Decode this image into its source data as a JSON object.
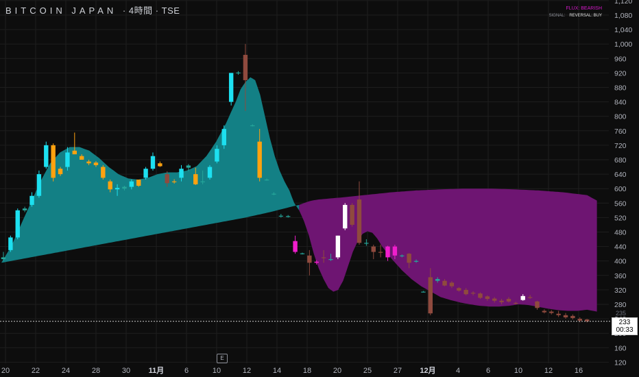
{
  "title": {
    "symbol": "BITCOIN JAPAN",
    "suffix": "· 4時間 · TSE"
  },
  "legend": {
    "flux_text": "FLUX: BEARISH",
    "signal_label": "SIGNAL:",
    "signal_value": "REVERSAL: BUY"
  },
  "colors": {
    "bg": "#0d0d0d",
    "grid": "#1e1e1e",
    "teal_fill": "#138085",
    "purple_fill": "#6e1572",
    "cyan": "#1de0f0",
    "white": "#ffffff",
    "orange": "#ffa20f",
    "magenta": "#f01ecc",
    "brown": "#8f4a3e",
    "green": "#26a69a"
  },
  "price_axis": {
    "ticks": [
      120,
      160,
      200,
      240,
      280,
      320,
      360,
      400,
      440,
      480,
      520,
      560,
      600,
      640,
      680,
      720,
      760,
      800,
      840,
      880,
      920,
      960,
      1000,
      1040,
      1080,
      1120
    ]
  },
  "time_axis": {
    "ticks": [
      {
        "label": "20",
        "idx": 0
      },
      {
        "label": "22",
        "idx": 4
      },
      {
        "label": "24",
        "idx": 8
      },
      {
        "label": "28",
        "idx": 12
      },
      {
        "label": "30",
        "idx": 16
      },
      {
        "label": "11月",
        "idx": 20,
        "bold": true
      },
      {
        "label": "6",
        "idx": 24
      },
      {
        "label": "10",
        "idx": 28
      },
      {
        "label": "12",
        "idx": 32
      },
      {
        "label": "14",
        "idx": 36
      },
      {
        "label": "18",
        "idx": 40
      },
      {
        "label": "20",
        "idx": 44
      },
      {
        "label": "25",
        "idx": 48
      },
      {
        "label": "27",
        "idx": 52
      },
      {
        "label": "12月",
        "idx": 56,
        "bold": true
      },
      {
        "label": "4",
        "idx": 60
      },
      {
        "label": "6",
        "idx": 64
      },
      {
        "label": "10",
        "idx": 68
      },
      {
        "label": "12",
        "idx": 72
      },
      {
        "label": "16",
        "idx": 76
      }
    ]
  },
  "earnings_badge": "E",
  "last_price": {
    "value": "233",
    "countdown": "00:33",
    "prev": "235"
  },
  "chart_data": {
    "type": "candlestick",
    "ylim": [
      110,
      1140
    ],
    "candles": [
      {
        "o": 405,
        "h": 425,
        "l": 400,
        "c": 410,
        "col": "green"
      },
      {
        "o": 430,
        "h": 470,
        "l": 425,
        "c": 465,
        "col": "cyan"
      },
      {
        "o": 465,
        "h": 545,
        "l": 460,
        "c": 540,
        "col": "cyan"
      },
      {
        "o": 540,
        "h": 550,
        "l": 535,
        "c": 545,
        "col": "green"
      },
      {
        "o": 555,
        "h": 590,
        "l": 550,
        "c": 580,
        "col": "cyan"
      },
      {
        "o": 580,
        "h": 650,
        "l": 575,
        "c": 640,
        "col": "cyan"
      },
      {
        "o": 660,
        "h": 730,
        "l": 655,
        "c": 720,
        "col": "cyan"
      },
      {
        "o": 720,
        "h": 725,
        "l": 620,
        "c": 630,
        "col": "orange"
      },
      {
        "o": 640,
        "h": 660,
        "l": 635,
        "c": 655,
        "col": "orange"
      },
      {
        "o": 660,
        "h": 715,
        "l": 650,
        "c": 700,
        "col": "cyan"
      },
      {
        "o": 705,
        "h": 755,
        "l": 695,
        "c": 695,
        "col": "orange"
      },
      {
        "o": 690,
        "h": 695,
        "l": 680,
        "c": 680,
        "col": "orange"
      },
      {
        "o": 675,
        "h": 680,
        "l": 665,
        "c": 670,
        "col": "orange"
      },
      {
        "o": 672,
        "h": 676,
        "l": 660,
        "c": 665,
        "col": "orange"
      },
      {
        "o": 660,
        "h": 665,
        "l": 625,
        "c": 630,
        "col": "orange"
      },
      {
        "o": 620,
        "h": 625,
        "l": 590,
        "c": 598,
        "col": "orange"
      },
      {
        "o": 598,
        "h": 612,
        "l": 580,
        "c": 602,
        "col": "cyan"
      },
      {
        "o": 600,
        "h": 608,
        "l": 595,
        "c": 605,
        "col": "green"
      },
      {
        "o": 605,
        "h": 625,
        "l": 598,
        "c": 620,
        "col": "cyan"
      },
      {
        "o": 625,
        "h": 615,
        "l": 605,
        "c": 608,
        "col": "orange"
      },
      {
        "o": 630,
        "h": 660,
        "l": 625,
        "c": 655,
        "col": "cyan"
      },
      {
        "o": 655,
        "h": 700,
        "l": 650,
        "c": 690,
        "col": "cyan"
      },
      {
        "o": 670,
        "h": 675,
        "l": 660,
        "c": 662,
        "col": "orange"
      },
      {
        "o": 640,
        "h": 648,
        "l": 605,
        "c": 615,
        "col": "brown"
      },
      {
        "o": 620,
        "h": 626,
        "l": 614,
        "c": 620,
        "col": "orange"
      },
      {
        "o": 630,
        "h": 665,
        "l": 620,
        "c": 655,
        "col": "cyan"
      },
      {
        "o": 658,
        "h": 668,
        "l": 648,
        "c": 664,
        "col": "green"
      },
      {
        "o": 640,
        "h": 658,
        "l": 610,
        "c": 612,
        "col": "orange"
      },
      {
        "o": 618,
        "h": 650,
        "l": 612,
        "c": 620,
        "col": "green"
      },
      {
        "o": 630,
        "h": 665,
        "l": 625,
        "c": 660,
        "col": "cyan"
      },
      {
        "o": 675,
        "h": 720,
        "l": 670,
        "c": 710,
        "col": "cyan"
      },
      {
        "o": 720,
        "h": 775,
        "l": 710,
        "c": 765,
        "col": "cyan"
      },
      {
        "o": 840,
        "h": 920,
        "l": 830,
        "c": 920,
        "col": "cyan"
      },
      {
        "o": 920,
        "h": 925,
        "l": 915,
        "c": 921,
        "col": "green"
      },
      {
        "o": 970,
        "h": 1000,
        "l": 815,
        "c": 900,
        "col": "brown"
      },
      {
        "o": 775,
        "h": 778,
        "l": 772,
        "c": 775,
        "col": "green"
      },
      {
        "o": 730,
        "h": 765,
        "l": 620,
        "c": 630,
        "col": "orange"
      },
      {
        "o": 625,
        "h": 628,
        "l": 622,
        "c": 624,
        "col": "green"
      },
      {
        "o": 585,
        "h": 590,
        "l": 582,
        "c": 586,
        "col": "green"
      },
      {
        "o": 525,
        "h": 530,
        "l": 520,
        "c": 525,
        "col": "green"
      },
      {
        "o": 524,
        "h": 527,
        "l": 520,
        "c": 523,
        "col": "green"
      },
      {
        "o": 455,
        "h": 470,
        "l": 420,
        "c": 425,
        "col": "magenta"
      },
      {
        "o": 420,
        "h": 423,
        "l": 418,
        "c": 421,
        "col": "green"
      },
      {
        "o": 415,
        "h": 430,
        "l": 360,
        "c": 395,
        "col": "brown"
      },
      {
        "o": 398,
        "h": 402,
        "l": 390,
        "c": 395,
        "col": "magenta"
      },
      {
        "o": 410,
        "h": 430,
        "l": 395,
        "c": 410,
        "col": "brown"
      },
      {
        "o": 405,
        "h": 420,
        "l": 400,
        "c": 405,
        "col": "green"
      },
      {
        "o": 410,
        "h": 470,
        "l": 405,
        "c": 470,
        "col": "white"
      },
      {
        "o": 490,
        "h": 560,
        "l": 485,
        "c": 555,
        "col": "white"
      },
      {
        "o": 555,
        "h": 560,
        "l": 495,
        "c": 500,
        "col": "brown"
      },
      {
        "o": 450,
        "h": 620,
        "l": 445,
        "c": 570,
        "col": "brown"
      },
      {
        "o": 448,
        "h": 460,
        "l": 442,
        "c": 450,
        "col": "green"
      },
      {
        "o": 440,
        "h": 445,
        "l": 405,
        "c": 425,
        "col": "brown"
      },
      {
        "o": 425,
        "h": 445,
        "l": 410,
        "c": 425,
        "col": "brown"
      },
      {
        "o": 440,
        "h": 442,
        "l": 400,
        "c": 410,
        "col": "magenta"
      },
      {
        "o": 440,
        "h": 445,
        "l": 405,
        "c": 415,
        "col": "magenta"
      },
      {
        "o": 415,
        "h": 418,
        "l": 410,
        "c": 413,
        "col": "green"
      },
      {
        "o": 420,
        "h": 422,
        "l": 380,
        "c": 395,
        "col": "brown"
      },
      {
        "o": 400,
        "h": 404,
        "l": 395,
        "c": 400,
        "col": "green"
      },
      {
        "o": 315,
        "h": 317,
        "l": 313,
        "c": 315,
        "col": "green"
      },
      {
        "o": 355,
        "h": 380,
        "l": 250,
        "c": 255,
        "col": "brown"
      },
      {
        "o": 350,
        "h": 355,
        "l": 340,
        "c": 345,
        "col": "green"
      },
      {
        "o": 345,
        "h": 350,
        "l": 330,
        "c": 332,
        "col": "brown"
      },
      {
        "o": 340,
        "h": 344,
        "l": 325,
        "c": 330,
        "col": "brown"
      },
      {
        "o": 325,
        "h": 328,
        "l": 315,
        "c": 318,
        "col": "brown"
      },
      {
        "o": 320,
        "h": 325,
        "l": 305,
        "c": 308,
        "col": "brown"
      },
      {
        "o": 310,
        "h": 316,
        "l": 305,
        "c": 312,
        "col": "brown"
      },
      {
        "o": 310,
        "h": 313,
        "l": 295,
        "c": 298,
        "col": "brown"
      },
      {
        "o": 302,
        "h": 305,
        "l": 290,
        "c": 295,
        "col": "brown"
      },
      {
        "o": 296,
        "h": 300,
        "l": 285,
        "c": 290,
        "col": "brown"
      },
      {
        "o": 290,
        "h": 295,
        "l": 280,
        "c": 286,
        "col": "brown"
      },
      {
        "o": 295,
        "h": 300,
        "l": 285,
        "c": 288,
        "col": "brown"
      },
      {
        "o": 284,
        "h": 287,
        "l": 280,
        "c": 282,
        "col": "brown"
      },
      {
        "o": 292,
        "h": 308,
        "l": 290,
        "c": 303,
        "col": "white"
      },
      {
        "o": 300,
        "h": 306,
        "l": 295,
        "c": 298,
        "col": "brown"
      },
      {
        "o": 288,
        "h": 290,
        "l": 265,
        "c": 270,
        "col": "brown"
      },
      {
        "o": 262,
        "h": 266,
        "l": 255,
        "c": 258,
        "col": "brown"
      },
      {
        "o": 260,
        "h": 264,
        "l": 252,
        "c": 256,
        "col": "brown"
      },
      {
        "o": 254,
        "h": 262,
        "l": 245,
        "c": 250,
        "col": "brown"
      },
      {
        "o": 250,
        "h": 256,
        "l": 240,
        "c": 244,
        "col": "brown"
      },
      {
        "o": 248,
        "h": 252,
        "l": 238,
        "c": 242,
        "col": "brown"
      },
      {
        "o": 240,
        "h": 244,
        "l": 230,
        "c": 235,
        "col": "brown"
      },
      {
        "o": 238,
        "h": 240,
        "l": 230,
        "c": 233,
        "col": "brown"
      }
    ],
    "cloud_upper": [
      [
        0,
        395
      ],
      [
        2,
        440
      ],
      [
        4,
        500
      ],
      [
        6,
        560
      ],
      [
        8,
        620
      ],
      [
        10,
        670
      ],
      [
        12,
        700
      ],
      [
        14,
        715
      ],
      [
        16,
        715
      ],
      [
        18,
        705
      ],
      [
        20,
        685
      ],
      [
        22,
        660
      ],
      [
        24,
        640
      ],
      [
        26,
        628
      ],
      [
        28,
        625
      ],
      [
        30,
        630
      ],
      [
        32,
        640
      ],
      [
        34,
        645
      ],
      [
        36,
        645
      ],
      [
        38,
        650
      ],
      [
        40,
        662
      ],
      [
        42,
        690
      ],
      [
        44,
        730
      ],
      [
        46,
        780
      ],
      [
        48,
        840
      ],
      [
        49,
        875
      ],
      [
        50,
        895
      ],
      [
        51,
        908
      ],
      [
        52,
        900
      ],
      [
        53,
        860
      ],
      [
        54,
        800
      ],
      [
        55,
        740
      ],
      [
        56,
        690
      ],
      [
        57,
        650
      ],
      [
        58,
        620
      ],
      [
        59,
        595
      ],
      [
        60,
        560
      ],
      [
        61,
        540
      ],
      [
        62,
        510
      ],
      [
        63,
        470
      ],
      [
        64,
        420
      ],
      [
        65,
        380
      ],
      [
        66,
        350
      ],
      [
        67,
        325
      ],
      [
        68,
        315
      ],
      [
        69,
        320
      ],
      [
        70,
        345
      ],
      [
        71,
        385
      ],
      [
        72,
        425
      ],
      [
        73,
        455
      ],
      [
        74,
        475
      ],
      [
        75,
        482
      ],
      [
        76,
        478
      ],
      [
        77,
        462
      ],
      [
        78,
        440
      ],
      [
        80,
        405
      ],
      [
        82,
        375
      ],
      [
        84,
        350
      ],
      [
        86,
        330
      ],
      [
        88,
        315
      ],
      [
        90,
        300
      ],
      [
        92,
        292
      ],
      [
        94,
        285
      ],
      [
        96,
        280
      ],
      [
        98,
        276
      ],
      [
        100,
        274
      ],
      [
        102,
        274
      ],
      [
        104,
        276
      ],
      [
        106,
        280
      ],
      [
        108,
        278
      ],
      [
        110,
        273
      ],
      [
        112,
        268
      ],
      [
        114,
        264
      ],
      [
        116,
        262
      ],
      [
        118,
        262
      ],
      [
        120,
        265
      ],
      [
        122,
        260
      ]
    ],
    "cloud_lower": [
      [
        0,
        395
      ],
      [
        10,
        420
      ],
      [
        20,
        445
      ],
      [
        30,
        470
      ],
      [
        40,
        495
      ],
      [
        50,
        520
      ],
      [
        55,
        535
      ],
      [
        60,
        552
      ],
      [
        61,
        555
      ],
      [
        62,
        560
      ],
      [
        63,
        565
      ],
      [
        64,
        568
      ],
      [
        65,
        570
      ],
      [
        70,
        576
      ],
      [
        75,
        583
      ],
      [
        80,
        590
      ],
      [
        85,
        595
      ],
      [
        90,
        598
      ],
      [
        95,
        600
      ],
      [
        100,
        600
      ],
      [
        105,
        598
      ],
      [
        110,
        595
      ],
      [
        115,
        590
      ],
      [
        120,
        582
      ],
      [
        122,
        567
      ]
    ],
    "cross_idx": 61
  }
}
